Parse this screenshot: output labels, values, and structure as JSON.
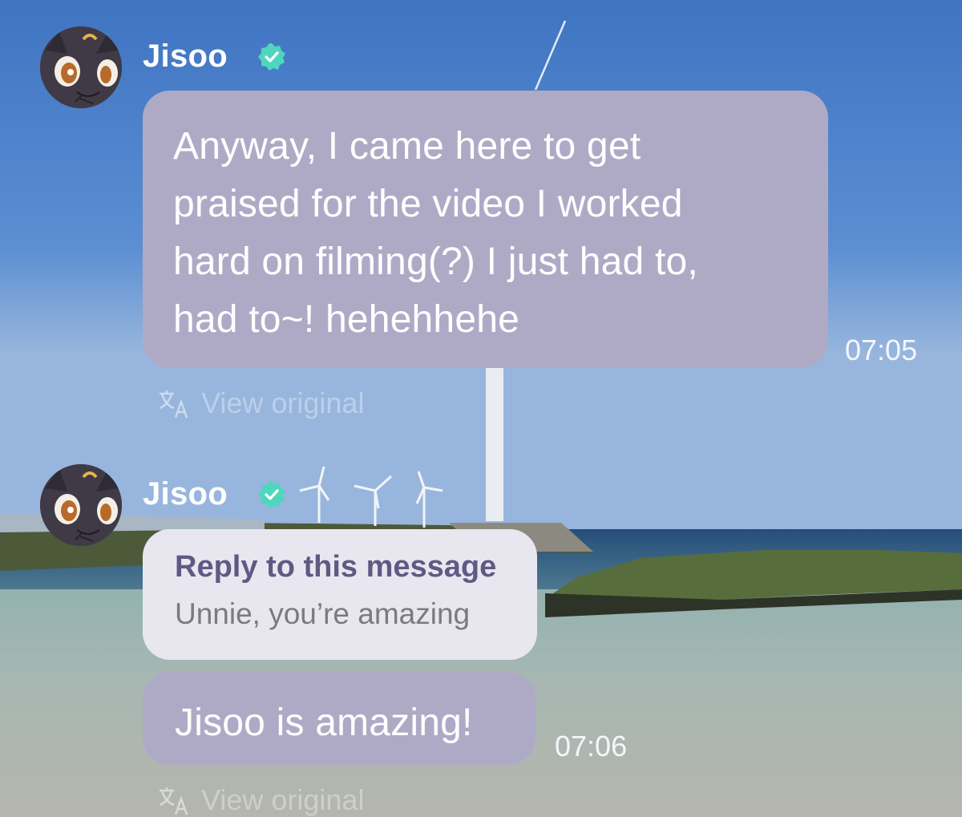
{
  "colors": {
    "bubble": "#aeaac6",
    "reply_card": "#e8e7ef",
    "reply_title": "#5f5a84",
    "verified_badge": "#4fd6be",
    "sky": "#3f79c8",
    "sea": "#7a9fa6"
  },
  "messages": [
    {
      "sender": "Jisoo",
      "verified_icon": "verified-badge-icon",
      "avatar_icon": "cat-avatar-icon",
      "text": "Anyway, I came here to get\npraised for the video I worked\nhard on filming(?) I just had to,\nhad to~! hehehhehe",
      "time": "07:05",
      "view_original": {
        "icon": "translate-icon",
        "label": "View original"
      }
    },
    {
      "sender": "Jisoo",
      "verified_icon": "verified-badge-icon",
      "avatar_icon": "cat-avatar-icon",
      "reply_card": {
        "title": "Reply to this message",
        "quote": "Unnie, you’re amazing"
      },
      "text": "Jisoo is amazing!",
      "time": "07:06",
      "view_original": {
        "icon": "translate-icon",
        "label": "View original"
      }
    }
  ]
}
